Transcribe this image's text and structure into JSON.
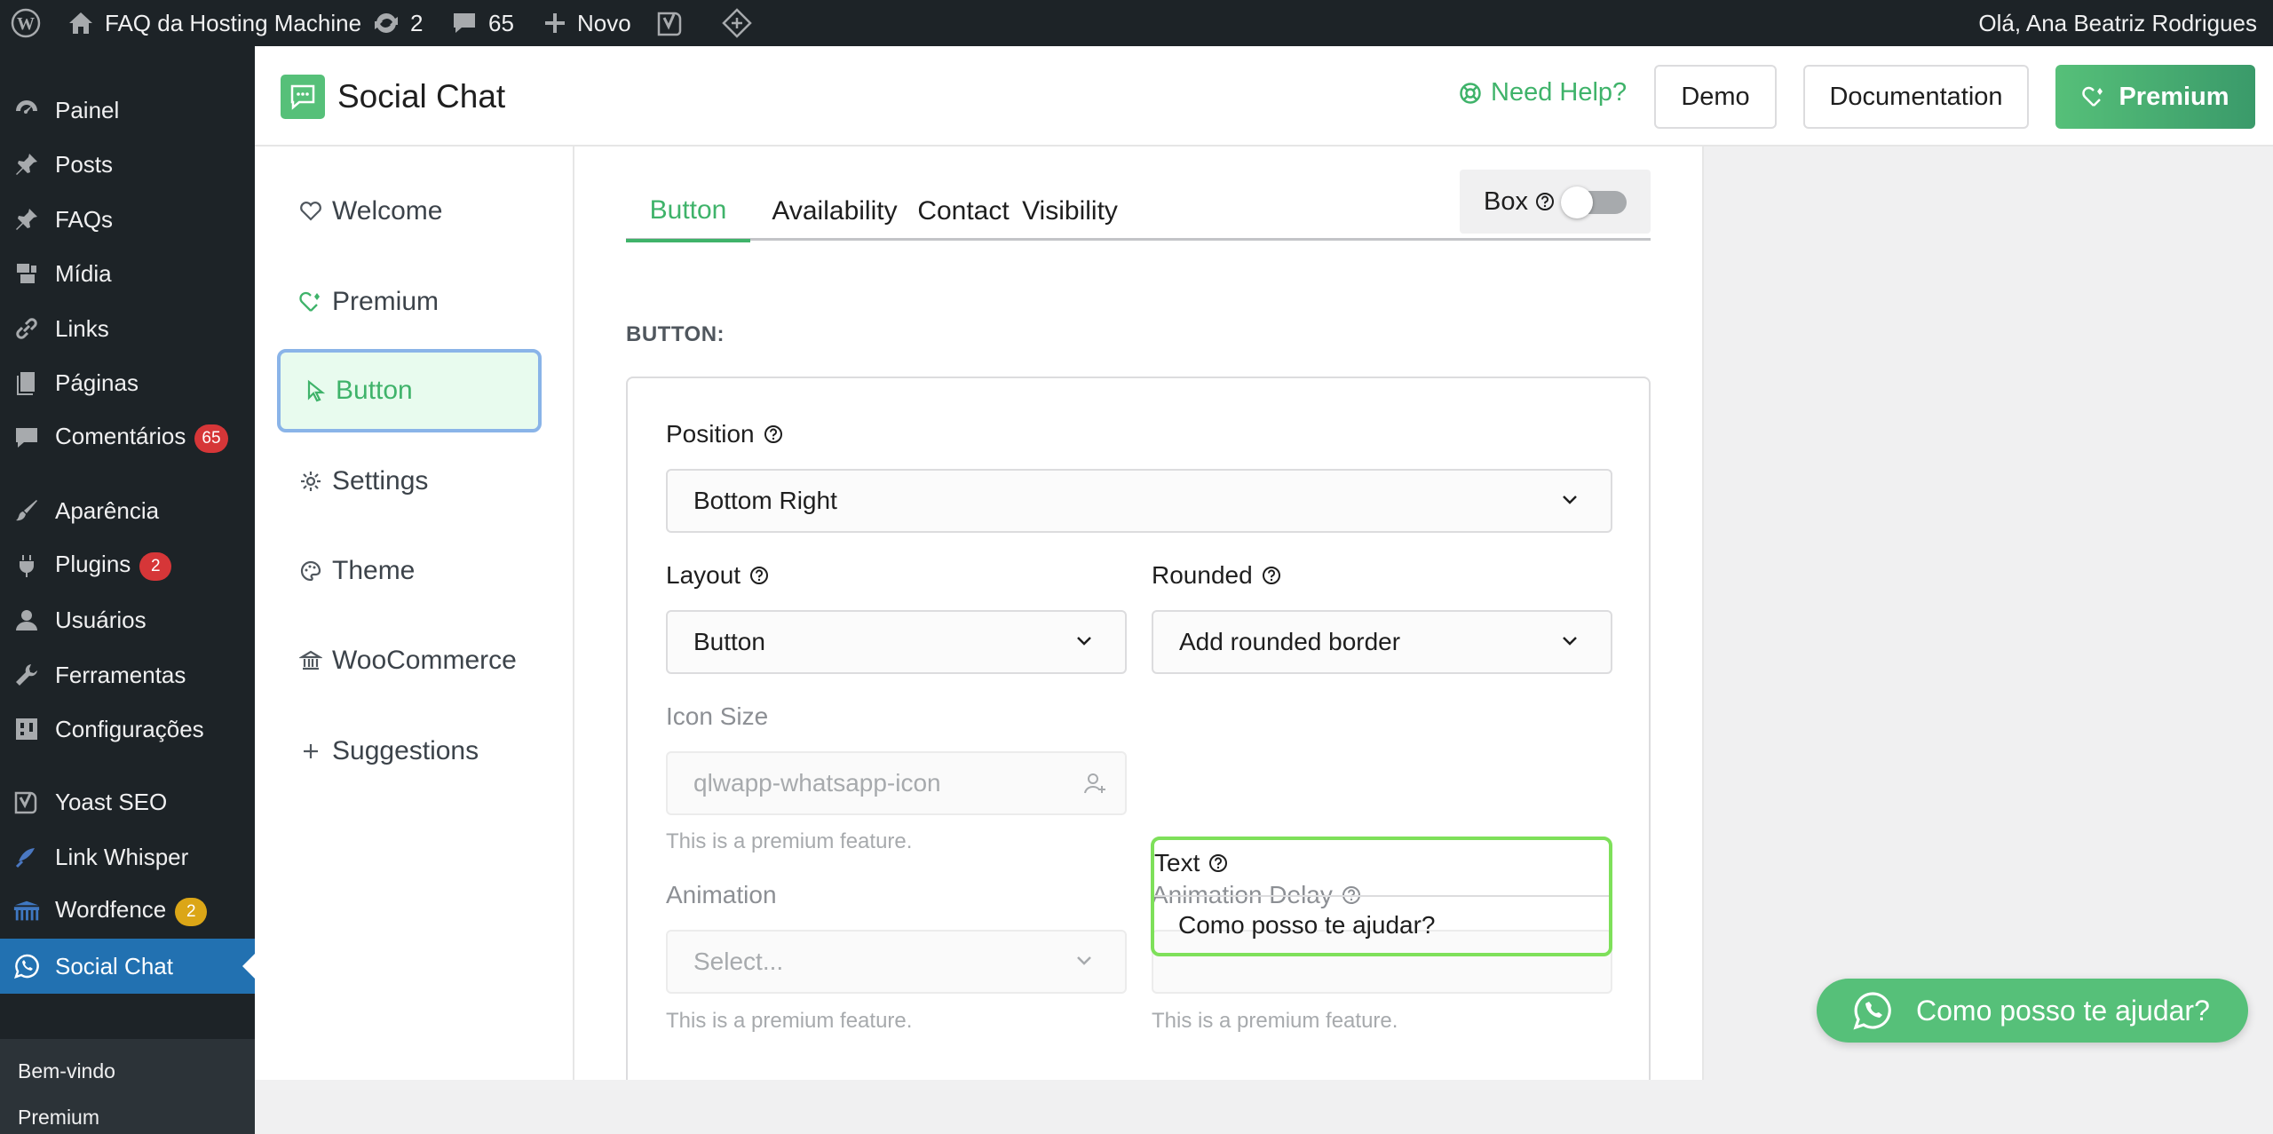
{
  "admin_bar": {
    "site_name": "FAQ da Hosting Machine",
    "updates_count": "2",
    "comments_count": "65",
    "new_label": "Novo",
    "greeting": "Olá, Ana Beatriz Rodrigues"
  },
  "admin_menu": {
    "items": [
      {
        "label": "Painel",
        "icon": "dashboard-icon"
      },
      {
        "label": "Posts",
        "icon": "pin-icon"
      },
      {
        "label": "FAQs",
        "icon": "pin-icon"
      },
      {
        "label": "Mídia",
        "icon": "media-icon"
      },
      {
        "label": "Links",
        "icon": "link-icon"
      },
      {
        "label": "Páginas",
        "icon": "page-icon"
      },
      {
        "label": "Comentários",
        "icon": "comment-icon",
        "badge": "65"
      },
      {
        "label": "Aparência",
        "icon": "brush-icon"
      },
      {
        "label": "Plugins",
        "icon": "plugin-icon",
        "badge": "2"
      },
      {
        "label": "Usuários",
        "icon": "user-icon"
      },
      {
        "label": "Ferramentas",
        "icon": "wrench-icon"
      },
      {
        "label": "Configurações",
        "icon": "settings-icon"
      },
      {
        "label": "Yoast SEO",
        "icon": "yoast-icon"
      },
      {
        "label": "Link Whisper",
        "icon": "whisper-icon"
      },
      {
        "label": "Wordfence",
        "icon": "wordfence-icon",
        "badge": "2"
      },
      {
        "label": "Social Chat",
        "icon": "whatsapp-icon"
      }
    ],
    "submenu": [
      "Bem-vindo",
      "Premium"
    ]
  },
  "plugin_header": {
    "title": "Social Chat",
    "help": "Need Help?",
    "demo": "Demo",
    "documentation": "Documentation",
    "premium": "Premium"
  },
  "plugin_nav": {
    "items": [
      "Welcome",
      "Premium",
      "Button",
      "Settings",
      "Theme",
      "WooCommerce",
      "Suggestions"
    ]
  },
  "tabs": [
    "Button",
    "Availability",
    "Contact",
    "Visibility"
  ],
  "box_toggle": {
    "label": "Box",
    "enabled": false
  },
  "section": {
    "title": "BUTTON:"
  },
  "fields": {
    "position": {
      "label": "Position",
      "value": "Bottom Right"
    },
    "layout": {
      "label": "Layout",
      "value": "Button"
    },
    "rounded": {
      "label": "Rounded",
      "value": "Add rounded border"
    },
    "icon_size": {
      "label": "Icon Size",
      "value": "qlwapp-whatsapp-icon",
      "hint": "This is a premium feature."
    },
    "text": {
      "label": "Text",
      "value": "Como posso te ajudar?"
    },
    "animation": {
      "label": "Animation",
      "placeholder": "Select...",
      "hint": "This is a premium feature."
    },
    "animation_delay": {
      "label": "Animation Delay",
      "hint": "This is a premium feature."
    }
  },
  "chat_button": {
    "label": "Como posso te ajudar?"
  },
  "colors": {
    "accent": "#3fb36a",
    "admin_dark": "#1d2327",
    "admin_current": "#2271b1",
    "badge_red": "#d63638",
    "badge_yellow": "#dba617"
  }
}
